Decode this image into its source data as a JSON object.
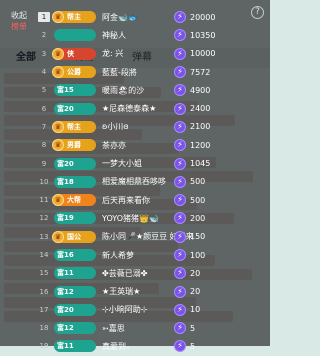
{
  "side": {
    "line1": "收起",
    "line2": "榜单"
  },
  "help_icon": "?",
  "bg_tabs": [
    "全部",
    "礼物",
    "弹幕"
  ],
  "rows": [
    {
      "rank": "1",
      "badge": "帮主",
      "style": "gold",
      "crown": "♛",
      "name": "阿金🐋🐟",
      "value": "20000"
    },
    {
      "rank": "2",
      "badge": "",
      "style": "teal",
      "crown": "",
      "name": "神秘人",
      "value": "10350"
    },
    {
      "rank": "3",
      "badge": "侠",
      "style": "red",
      "crown": "♛",
      "name": "龙: 兴",
      "value": "10000"
    },
    {
      "rank": "4",
      "badge": "公爵",
      "style": "gold",
      "crown": "♛",
      "name": "藍藍-段將",
      "value": "7572"
    },
    {
      "rank": "5",
      "badge": "富15",
      "style": "teal",
      "crown": "",
      "name": "暖雨🏖的沙",
      "value": "4900"
    },
    {
      "rank": "6",
      "badge": "富20",
      "style": "teal",
      "crown": "",
      "name": "★尼森德泰森★",
      "value": "2400"
    },
    {
      "rank": "7",
      "badge": "帮主",
      "style": "gold",
      "crown": "♛",
      "name": "ʚ小川ɞ",
      "value": "2100"
    },
    {
      "rank": "8",
      "badge": "男爵",
      "style": "gold",
      "crown": "♛",
      "name": "茶亦亦",
      "value": "1200"
    },
    {
      "rank": "9",
      "badge": "富20",
      "style": "teal",
      "crown": "",
      "name": "一梦大小姐",
      "value": "1045"
    },
    {
      "rank": "10",
      "badge": "富18",
      "style": "teal",
      "crown": "",
      "name": "相爱魔相鼎吞哆哆",
      "value": "500"
    },
    {
      "rank": "11",
      "badge": "大帮",
      "style": "orange",
      "crown": "♛",
      "name": "后天再来看你",
      "value": "500"
    },
    {
      "rank": "12",
      "badge": "富19",
      "style": "teal",
      "crown": "",
      "name": "YOYO猪猪👑🐋",
      "value": "200"
    },
    {
      "rank": "13",
      "badge": "国公",
      "style": "gold",
      "crown": "♛",
      "name": "陈小同🎤★颜豆豆 好运来",
      "value": "150"
    },
    {
      "rank": "14",
      "badge": "富16",
      "style": "teal",
      "crown": "",
      "name": "新人希萝",
      "value": "100"
    },
    {
      "rank": "15",
      "badge": "富11",
      "style": "teal",
      "crown": "",
      "name": "✤芸薇已溺✤",
      "value": "20"
    },
    {
      "rank": "16",
      "badge": "富12",
      "style": "teal",
      "crown": "",
      "name": "★王英瑞★",
      "value": "20"
    },
    {
      "rank": "17",
      "badge": "富20",
      "style": "teal",
      "crown": "",
      "name": "⊹小晌阿助⊹",
      "value": "10"
    },
    {
      "rank": "18",
      "badge": "富12",
      "style": "teal",
      "crown": "",
      "name": "➳嘉思",
      "value": "5"
    },
    {
      "rank": "19",
      "badge": "富11",
      "style": "teal",
      "crown": "",
      "name": "真爱到₊",
      "value": "5"
    }
  ]
}
